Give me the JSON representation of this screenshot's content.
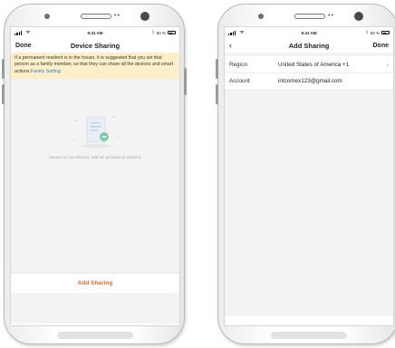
{
  "status_bar": {
    "time": "9:41 AM",
    "battery": "60 %",
    "wifi_icon": "wifi-icon",
    "bluetooth_icon": "bluetooth-icon"
  },
  "device_sharing": {
    "nav": {
      "left": "Done",
      "title": "Device Sharing"
    },
    "notice": {
      "text": "If a permanent resident is in the house, it is suggested that you set that person as a family member, so that they can share all the devices and smart actions.",
      "link": "Family Setting"
    },
    "empty_message": "Device is not shared, add an account to share it",
    "add_button": "Add Sharing",
    "accent_color": "#f06a2a"
  },
  "add_sharing": {
    "nav": {
      "back_icon": "back-chevron-icon",
      "title": "Add Sharing",
      "right": "Done"
    },
    "rows": [
      {
        "label": "Region",
        "value": "United States of America +1"
      },
      {
        "label": "Account",
        "value": "intcomex123@gmail.com"
      }
    ]
  }
}
